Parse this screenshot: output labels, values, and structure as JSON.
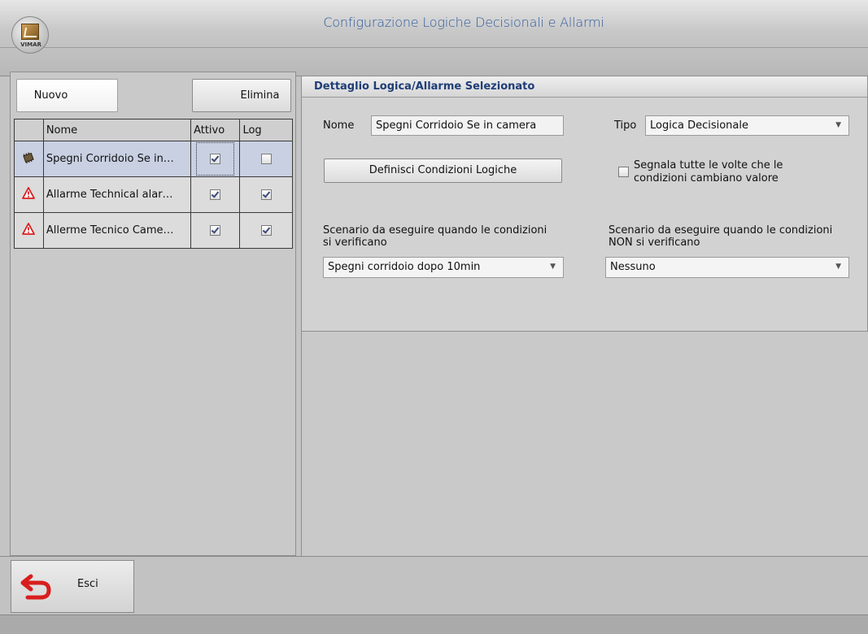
{
  "window": {
    "title": "Configurazione Logiche Decisionali e Allarmi",
    "logo_text": "VIMAR"
  },
  "toolbar": {
    "new_label": "Nuovo",
    "delete_label": "Elimina"
  },
  "table": {
    "columns": [
      "",
      "Nome",
      "Attivo",
      "Log"
    ],
    "rows": [
      {
        "icon": "chip-icon",
        "name": "Spegni Corridoio Se in…",
        "active": true,
        "log": false,
        "selected": true
      },
      {
        "icon": "warning-icon",
        "name": "Allarme Technical alar…",
        "active": true,
        "log": true,
        "selected": false
      },
      {
        "icon": "warning-icon",
        "name": "Allerme Tecnico Came…",
        "active": true,
        "log": true,
        "selected": false
      }
    ]
  },
  "detail": {
    "header": "Dettaglio Logica/Allarme Selezionato",
    "name_label": "Nome",
    "name_value": "Spegni Corridoio Se in camera",
    "type_label": "Tipo",
    "type_value": "Logica Decisionale",
    "define_button": "Definisci Condizioni Logiche",
    "signal_checkbox_line1": "Segnala tutte le volte che le",
    "signal_checkbox_line2": "condizioni cambiano valore",
    "signal_checked": false,
    "scenario_true_label_line1": "Scenario da eseguire quando le condizioni",
    "scenario_true_label_line2": "si verificano",
    "scenario_true_value": "Spegni corridoio dopo 10min",
    "scenario_false_label_line1": "Scenario da eseguire quando le condizioni",
    "scenario_false_label_line2": "NON si verificano",
    "scenario_false_value": "Nessuno"
  },
  "footer": {
    "exit_label": "Esci"
  },
  "colors": {
    "title_blue": "#2e5a9c",
    "header_blue": "#1f3e78",
    "selected_row": "#c8d0e2",
    "exit_icon_red": "#d81e1e"
  }
}
